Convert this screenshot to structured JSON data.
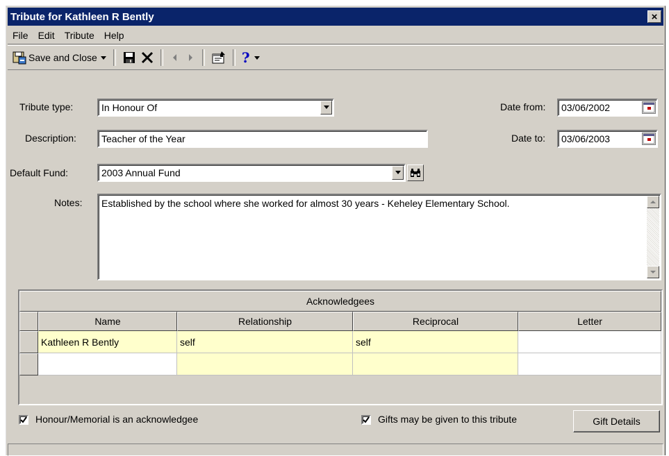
{
  "window": {
    "title": "Tribute for Kathleen R Bently",
    "close_label": "×"
  },
  "menu": [
    "File",
    "Edit",
    "Tribute",
    "Help"
  ],
  "toolbar": {
    "save_close_label": "Save and Close",
    "help_label": "?"
  },
  "form": {
    "tribute_type_label": "Tribute type:",
    "tribute_type_value": "In Honour Of",
    "description_label": "Description:",
    "description_value": "Teacher of the Year",
    "default_fund_label": "Default Fund:",
    "default_fund_value": "2003 Annual Fund",
    "notes_label": "Notes:",
    "notes_value": "Established by the school where she worked for almost 30 years - Keheley Elementary School.",
    "date_from_label": "Date from:",
    "date_from_value": "03/06/2002",
    "date_to_label": "Date to:",
    "date_to_value": "03/06/2003"
  },
  "acknowledgees": {
    "caption": "Acknowledgees",
    "columns": [
      "Name",
      "Relationship",
      "Reciprocal",
      "Letter"
    ],
    "rows": [
      [
        "Kathleen R Bently",
        "self",
        "self",
        ""
      ],
      [
        "",
        "",
        "",
        ""
      ]
    ]
  },
  "options": {
    "honour_memorial_label": "Honour/Memorial is an acknowledgee",
    "honour_memorial_checked": true,
    "gifts_label": "Gifts may be given to this tribute",
    "gifts_checked": true,
    "gift_details_label": "Gift Details"
  },
  "colors": {
    "titlebar": "#0a246a",
    "chrome": "#d4d0c8",
    "editable_cell": "#ffffcc"
  }
}
